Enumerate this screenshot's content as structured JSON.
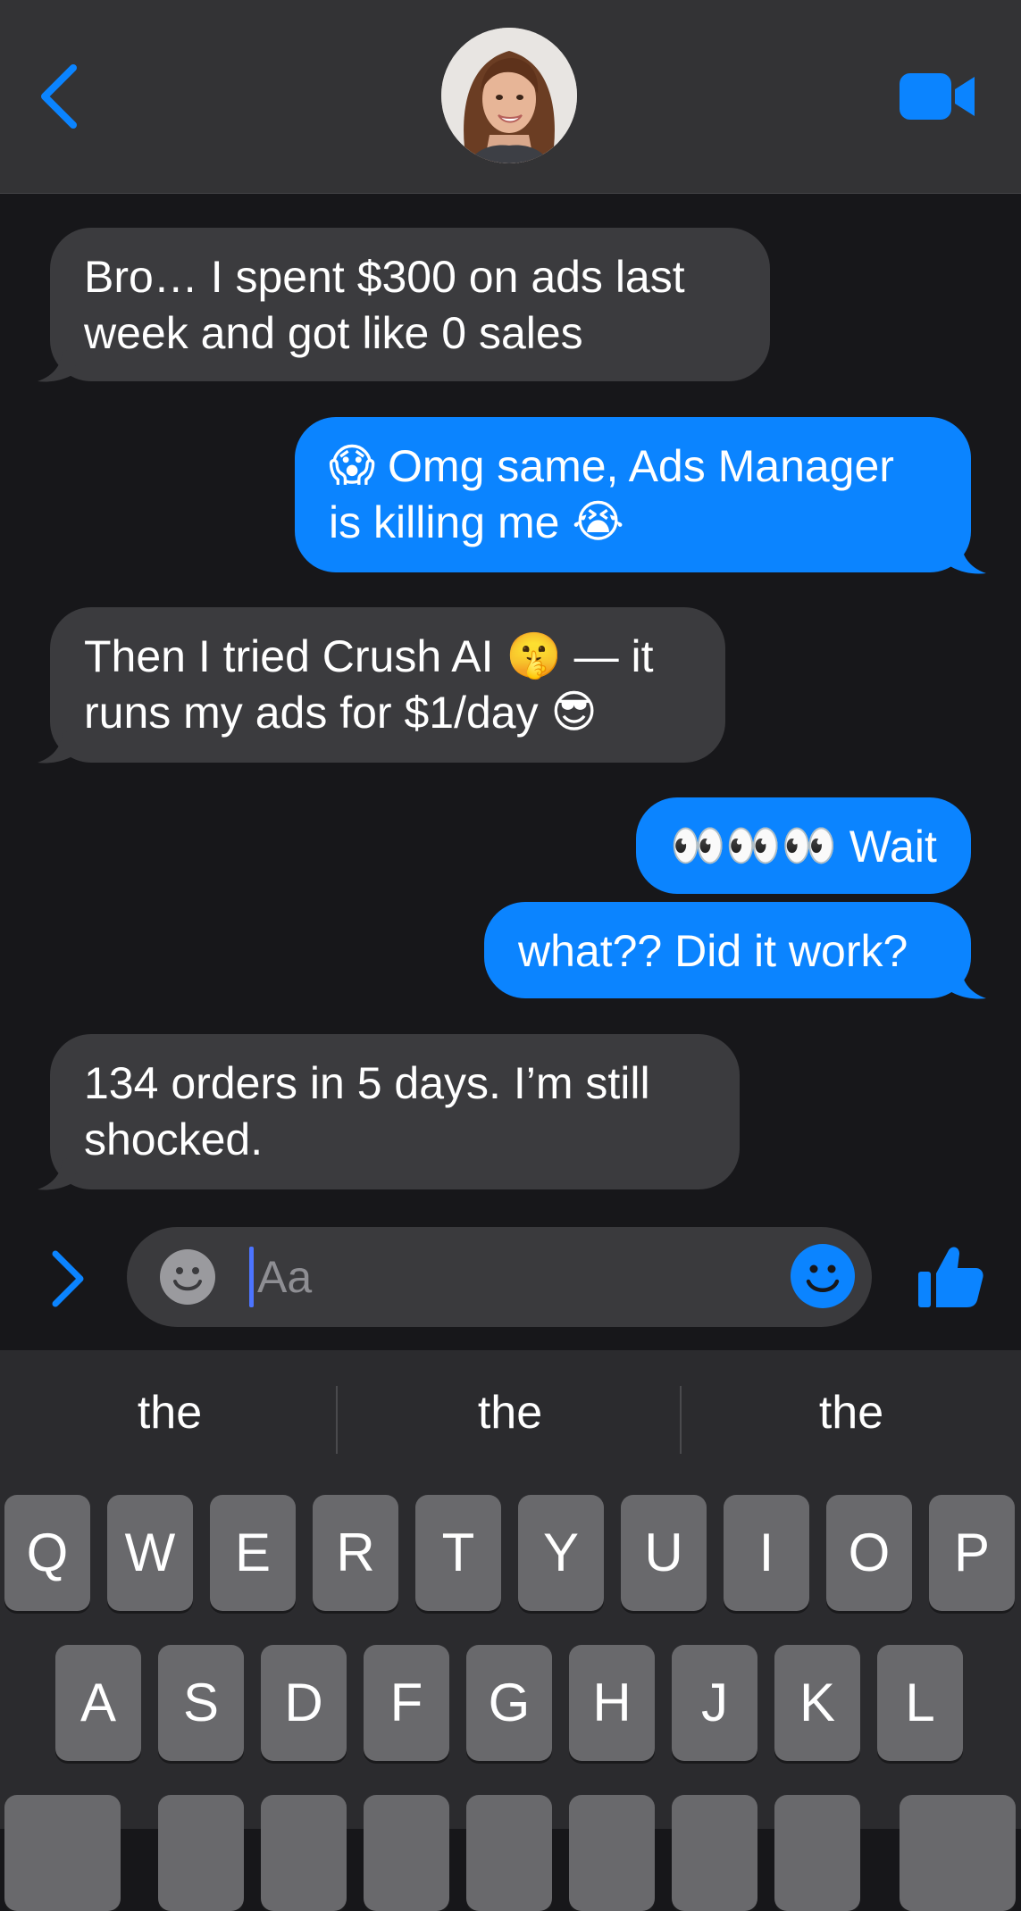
{
  "header": {
    "back_icon": "chevron-left-icon",
    "video_icon": "video-camera-icon",
    "accent_color": "#0b84ff"
  },
  "messages": [
    {
      "direction": "incoming",
      "lines": [
        "Bro… I spent $300 on ads last",
        "week and got like 0 sales"
      ]
    },
    {
      "direction": "outgoing",
      "lines": [
        "Omg same, Ads Manager",
        "is killing me"
      ],
      "emojis": [
        "😱",
        "😭"
      ]
    },
    {
      "direction": "incoming",
      "lines": [
        "Then I tried Crush AI",
        "— it",
        "runs my ads for $1/day"
      ],
      "emojis": [
        "🤫",
        "😎"
      ]
    },
    {
      "direction": "outgoing",
      "lines": [
        "Wait"
      ],
      "emojis": [
        "👀👀👀"
      ]
    },
    {
      "direction": "outgoing",
      "lines": [
        "what?? Did it work?"
      ]
    },
    {
      "direction": "incoming",
      "lines": [
        "134 orders in 5 days. I’m still",
        "shocked."
      ]
    }
  ],
  "composer": {
    "placeholder": "Aa",
    "expand_icon": "chevron-right-icon",
    "emoji_icon": "smiley-icon",
    "like_icon": "thumbs-up-icon"
  },
  "keyboard": {
    "suggestions": [
      "the",
      "the",
      "the"
    ],
    "row1": [
      "Q",
      "W",
      "E",
      "R",
      "T",
      "Y",
      "U",
      "I",
      "O",
      "P"
    ],
    "row2": [
      "A",
      "S",
      "D",
      "F",
      "G",
      "H",
      "J",
      "K",
      "L"
    ]
  }
}
